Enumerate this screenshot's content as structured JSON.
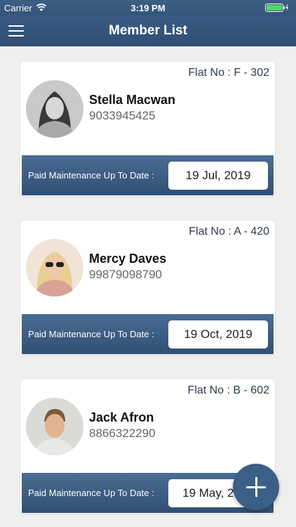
{
  "status": {
    "carrier": "Carrier",
    "time": "3:19 PM"
  },
  "header": {
    "title": "Member List"
  },
  "members": [
    {
      "flat": "Flat No : F - 302",
      "name": "Stella Macwan",
      "phone": "9033945425",
      "maintenance_label": "Paid Maintenance Up To Date :",
      "date": "19 Jul, 2019"
    },
    {
      "flat": "Flat No : A - 420",
      "name": "Mercy Daves",
      "phone": "99879098790",
      "maintenance_label": "Paid Maintenance Up To Date :",
      "date": "19 Oct, 2019"
    },
    {
      "flat": "Flat No : B - 602",
      "name": "Jack Afron",
      "phone": "8866322290",
      "maintenance_label": "Paid Maintenance Up To Date :",
      "date": "19 May, 2019"
    }
  ],
  "colors": {
    "header": "#34557a",
    "bar": "#3d5e84",
    "battery": "#4cd964",
    "background": "#efefef"
  },
  "icons": {
    "menu": "hamburger-icon",
    "add": "plus-icon",
    "wifi": "wifi-icon",
    "battery": "battery-icon"
  }
}
